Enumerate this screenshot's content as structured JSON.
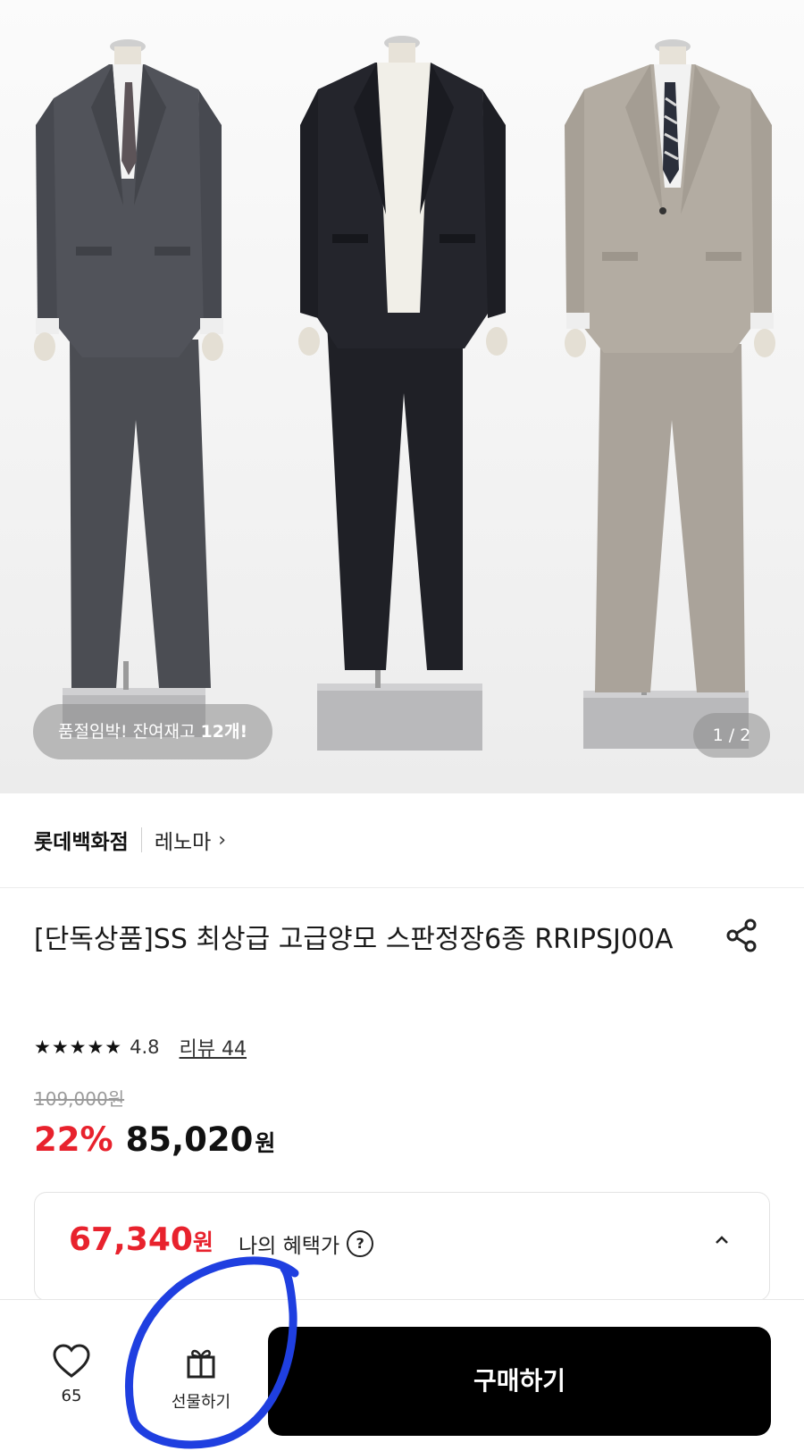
{
  "gallery": {
    "stock_prefix": "품절임박! 잔여재고 ",
    "stock_count": "12개!",
    "pager": "1 / 2"
  },
  "brand": {
    "store": "롯데백화점",
    "name": "레노마",
    "chevron": "›"
  },
  "product": {
    "title": "[단독상품]SS 최상급 고급양모 스판정장6종 RRIPSJ00A",
    "stars": "★★★★★",
    "rating": "4.8",
    "review_link": "리뷰 44",
    "original_price": "109,000원",
    "discount": "22%",
    "price": "85,020",
    "price_unit": "원"
  },
  "benefit": {
    "price": "67,340",
    "unit": "원",
    "label": "나의 혜택가",
    "help_symbol": "?"
  },
  "bottom_bar": {
    "wish_count": "65",
    "gift_label": "선물하기",
    "buy_label": "구매하기"
  },
  "colors": {
    "discount_red": "#e8222d",
    "buy_button": "#000000",
    "annotation_blue": "#1f3fe0"
  },
  "icons": [
    "heart-icon",
    "gift-icon",
    "share-icon",
    "help-icon",
    "chevron-up-icon",
    "chevron-right-icon"
  ]
}
